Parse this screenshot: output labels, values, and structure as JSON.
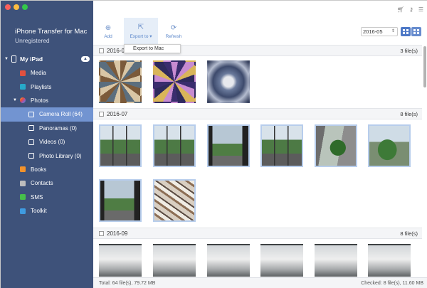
{
  "app": {
    "title": "iPhone Transfer for Mac",
    "subtitle": "Unregistered"
  },
  "device": {
    "label": "My iPad"
  },
  "sidebar": {
    "items": [
      {
        "label": "Media",
        "icon": "media-icon"
      },
      {
        "label": "Playlists",
        "icon": "playlists-icon"
      },
      {
        "label": "Photos",
        "icon": "photos-icon"
      },
      {
        "label": "Camera Roll (64)",
        "icon": "camera-icon"
      },
      {
        "label": "Panoramas (0)",
        "icon": "camera-icon"
      },
      {
        "label": "Videos (0)",
        "icon": "camera-icon"
      },
      {
        "label": "Photo Library (0)",
        "icon": "camera-icon"
      },
      {
        "label": "Books",
        "icon": "books-icon"
      },
      {
        "label": "Contacts",
        "icon": "contacts-icon"
      },
      {
        "label": "SMS",
        "icon": "sms-icon"
      },
      {
        "label": "Toolkit",
        "icon": "toolkit-icon"
      }
    ],
    "active_index": 3
  },
  "toolbar": {
    "add_label": "Add",
    "export_label": "Export to",
    "refresh_label": "Refresh",
    "export_menu_item": "Export to Mac"
  },
  "filter": {
    "date_value": "2016-05"
  },
  "groups": [
    {
      "label": "2016-0",
      "count": "3 file(s)"
    },
    {
      "label": "2016-07",
      "count": "8 file(s)"
    },
    {
      "label": "2016-09",
      "count": "8 file(s)"
    }
  ],
  "status": {
    "total": "Total: 64 file(s), 79.72 MB",
    "checked": "Checked: 8 file(s), 11.60 MB"
  },
  "colors": {
    "sidebar_bg": "#3e527a",
    "sidebar_active": "#7294d1",
    "accent": "#4d78c6"
  }
}
